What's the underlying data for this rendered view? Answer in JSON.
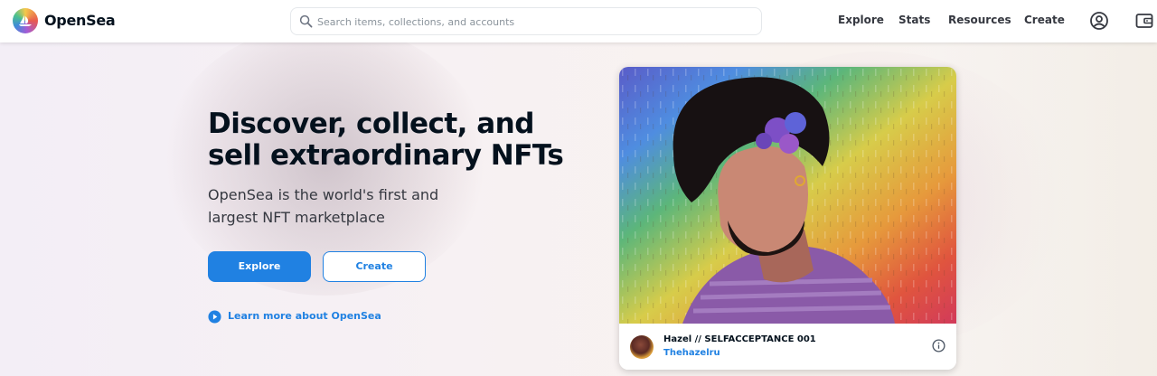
{
  "header": {
    "brand": "OpenSea",
    "search_placeholder": "Search items, collections, and accounts",
    "nav": [
      "Explore",
      "Stats",
      "Resources",
      "Create"
    ],
    "icons": [
      "account-circle-icon",
      "wallet-icon"
    ]
  },
  "hero": {
    "title": "Discover, collect, and sell extraordinary NFTs",
    "subtitle": "OpenSea is the world's first and largest NFT marketplace",
    "explore_label": "Explore",
    "create_label": "Create",
    "learn_more": "Learn more about OpenSea"
  },
  "featured": {
    "name": "Hazel // SELFACCEPTANCE 001",
    "creator": "Thehazelru"
  },
  "colors": {
    "accent": "#2081e2",
    "text": "#04111d"
  }
}
